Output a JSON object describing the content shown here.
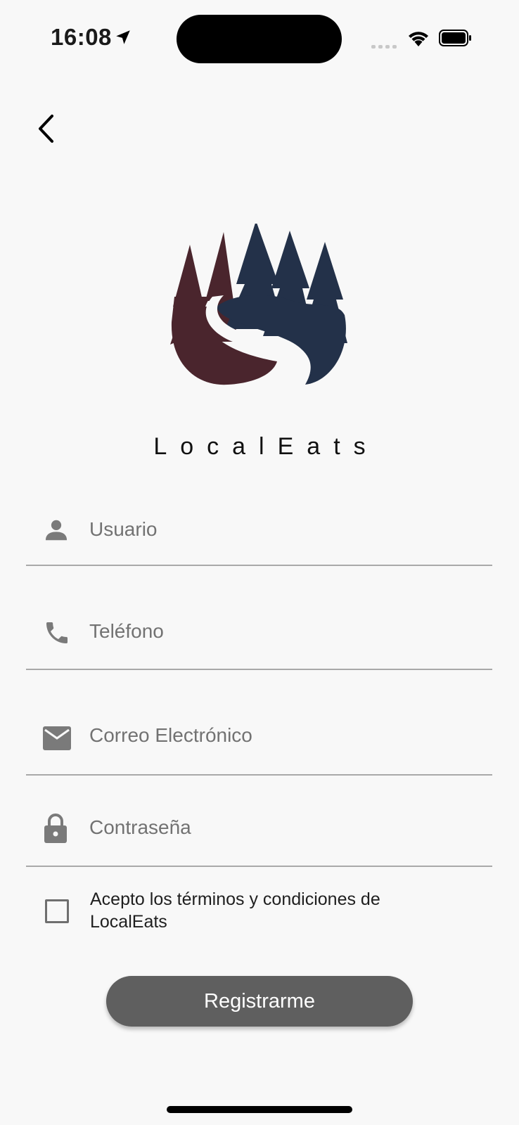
{
  "status_bar": {
    "time": "16:08",
    "icons": [
      "location-arrow-icon",
      "signal-icon",
      "wifi-icon",
      "battery-icon"
    ]
  },
  "navigation": {
    "back_icon": "chevron-left-icon"
  },
  "brand": {
    "logo_icon": "forest-river-logo-icon",
    "name": "LocalEats",
    "colors": {
      "maroon": "#4a252d",
      "navy": "#233149"
    }
  },
  "form": {
    "username": {
      "icon": "person-icon",
      "placeholder": "Usuario",
      "value": ""
    },
    "phone": {
      "icon": "phone-icon",
      "placeholder": "Teléfono",
      "value": ""
    },
    "email": {
      "icon": "mail-icon",
      "placeholder": "Correo Electrónico",
      "value": ""
    },
    "password": {
      "icon": "lock-icon",
      "placeholder": "Contraseña",
      "value": ""
    },
    "terms": {
      "checked": false,
      "label": "Acepto los términos y condiciones de LocalEats"
    },
    "submit_label": "Registrarme"
  },
  "theme": {
    "background": "#f8f8f8",
    "button": "#5f5f5f",
    "divider": "#a9a9a9",
    "icon_gray": "#7a7a7a"
  }
}
